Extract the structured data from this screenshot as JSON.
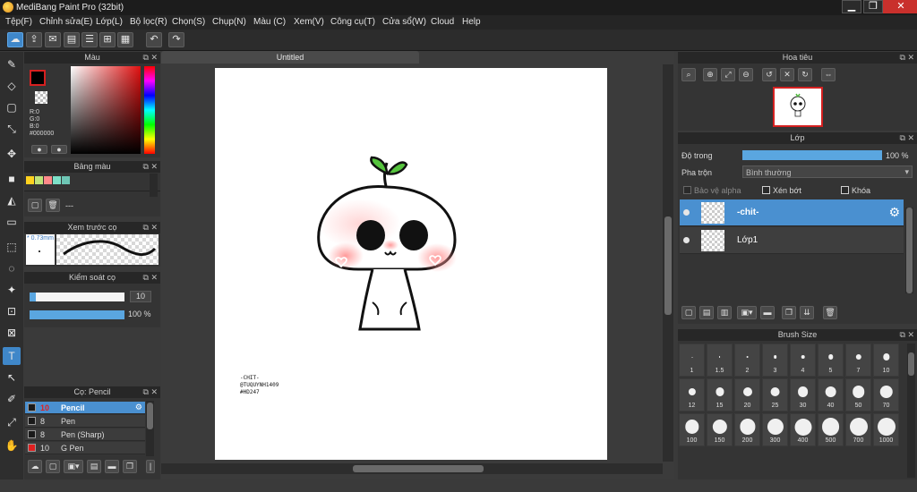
{
  "window": {
    "title": "MediBang Paint Pro (32bit)",
    "min_glyph": "▁",
    "max_glyph": "❐",
    "close_glyph": "✕"
  },
  "menu": [
    "Tệp(F)",
    "Chỉnh sửa(E)",
    "Lớp(L)",
    "Bộ lọc(R)",
    "Chọn(S)",
    "Chụp(N)",
    "Màu (C)",
    "Xem(V)",
    "Công cụ(T)",
    "Cửa sổ(W)",
    "Cloud",
    "Help"
  ],
  "toolbar": {
    "icons": [
      "cloud-icon",
      "share-icon",
      "speech-bubble-icon",
      "document-icon",
      "note-icon",
      "grid-icon",
      "table-icon"
    ],
    "undo_glyph": "↶",
    "redo_glyph": "↷"
  },
  "color_panel": {
    "title": "Màu",
    "r": "R:0",
    "g": "G:0",
    "b": "B:0",
    "hex": "#000000",
    "primary_color": "#000000",
    "accent_red": "#d62020"
  },
  "palette_panel": {
    "title": "Bảng màu",
    "swatches": [
      "#ffd21f",
      "#bfe37a",
      "#ff8a8a",
      "#7de0c8",
      "#6ec6b5"
    ],
    "extra": "---"
  },
  "brush_preview_panel": {
    "title": "Xem trước cọ",
    "size_text": "* 0.73mm"
  },
  "brush_control_panel": {
    "title": "Kiểm soát cọ",
    "size_value": "10",
    "opacity_value": "100 %",
    "size_fraction": 0.07,
    "opacity_fraction": 1.0
  },
  "brush_list_panel": {
    "title": "Cọ: Pencil",
    "items": [
      {
        "size": "10",
        "name": "Pencil",
        "color": "#1a1a1a",
        "selected": true
      },
      {
        "size": "8",
        "name": "Pen",
        "color": "#1a1a1a",
        "selected": false
      },
      {
        "size": "8",
        "name": "Pen (Sharp)",
        "color": "#1a1a1a",
        "selected": false
      },
      {
        "size": "10",
        "name": "G Pen",
        "color": "#e02020",
        "selected": false
      }
    ]
  },
  "document": {
    "tab_title": "Untitled",
    "signature_lines": [
      "-CHIT-",
      "@TUQUYNH1409",
      "#HD247"
    ]
  },
  "navigator_panel": {
    "title": "Hoa tiêu"
  },
  "layer_panel": {
    "title": "Lớp",
    "opacity_label": "Độ trong",
    "opacity_value": "100 %",
    "opacity_fraction": 1.0,
    "blend_label": "Pha trộn",
    "blend_value": "Bình thường",
    "protect_alpha": "Bảo vệ alpha",
    "clipping": "Xén bớt",
    "lock": "Khóa",
    "layers": [
      {
        "name": "-chit-",
        "selected": true
      },
      {
        "name": "Lớp1",
        "selected": false
      }
    ]
  },
  "brush_size_panel": {
    "title": "Brush Size",
    "sizes": [
      "1",
      "1.5",
      "2",
      "3",
      "4",
      "5",
      "7",
      "10",
      "12",
      "15",
      "20",
      "25",
      "30",
      "40",
      "50",
      "70",
      "100",
      "150",
      "200",
      "300",
      "400",
      "500",
      "700",
      "1000"
    ]
  }
}
